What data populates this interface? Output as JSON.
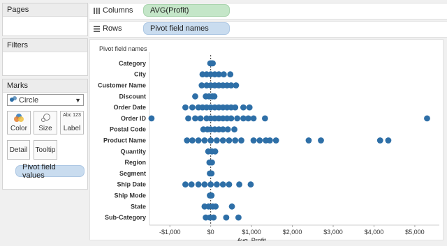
{
  "left_panels": {
    "pages": "Pages",
    "filters": "Filters",
    "marks": {
      "title": "Marks",
      "mark_type": "Circle",
      "buttons": [
        {
          "label": "Color",
          "icon": "color-icon"
        },
        {
          "label": "Size",
          "icon": "size-icon"
        },
        {
          "label": "Label",
          "icon": "label-icon",
          "icon_text": "Abc 123"
        },
        {
          "label": "Detail",
          "icon": "detail-icon"
        },
        {
          "label": "Tooltip",
          "icon": "tooltip-icon"
        }
      ],
      "field_pill": "Pivot field values"
    }
  },
  "shelves": {
    "columns": {
      "label": "Columns",
      "pill": "AVG(Profit)"
    },
    "rows": {
      "label": "Rows",
      "pill": "Pivot field names"
    }
  },
  "colors": {
    "mark": "#2e6fa7",
    "axis": "#cfcfcf",
    "zero_line": "#333333"
  },
  "chart_data": {
    "type": "scatter",
    "header": "Pivot field names",
    "xlabel": "Avg. Profit",
    "xlim": [
      -1500,
      5600
    ],
    "xticks": [
      "-$1,000",
      "$0",
      "$1,000",
      "$2,000",
      "$3,000",
      "$4,000",
      "$5,000"
    ],
    "xtick_values": [
      -1000,
      0,
      1000,
      2000,
      3000,
      4000,
      5000
    ],
    "categories": [
      "Category",
      "City",
      "Customer Name",
      "Discount",
      "Order Date",
      "Order ID",
      "Postal Code",
      "Product Name",
      "Quantity",
      "Region",
      "Segment",
      "Ship Date",
      "Ship Mode",
      "State",
      "Sub-Category"
    ],
    "series": [
      {
        "category": "Category",
        "x": [
          -10,
          20,
          50
        ]
      },
      {
        "category": "City",
        "x": [
          -200,
          -100,
          0,
          100,
          200,
          320,
          480
        ]
      },
      {
        "category": "Customer Name",
        "x": [
          -220,
          -100,
          0,
          100,
          200,
          300,
          400,
          500,
          620
        ]
      },
      {
        "category": "Discount",
        "x": [
          -380,
          -120,
          -40,
          40,
          90
        ]
      },
      {
        "category": "Order Date",
        "x": [
          -620,
          -450,
          -300,
          -200,
          -100,
          0,
          100,
          200,
          300,
          400,
          500,
          600,
          800,
          950
        ]
      },
      {
        "category": "Order ID",
        "x": [
          -1450,
          -550,
          -380,
          -250,
          -100,
          0,
          100,
          200,
          300,
          400,
          500,
          650,
          800,
          920,
          1050,
          1330,
          5300
        ]
      },
      {
        "category": "Postal Code",
        "x": [
          -180,
          -80,
          0,
          100,
          200,
          300,
          420,
          580
        ]
      },
      {
        "category": "Product Name",
        "x": [
          -580,
          -450,
          -300,
          -150,
          0,
          150,
          300,
          450,
          600,
          750,
          1050,
          1200,
          1350,
          1450,
          1600,
          2400,
          2700,
          4150,
          4350
        ]
      },
      {
        "category": "Quantity",
        "x": [
          -60,
          30,
          110
        ]
      },
      {
        "category": "Region",
        "x": [
          -30,
          30
        ]
      },
      {
        "category": "Segment",
        "x": [
          -20,
          20
        ]
      },
      {
        "category": "Ship Date",
        "x": [
          -620,
          -470,
          -300,
          -150,
          0,
          150,
          300,
          450,
          700,
          980
        ]
      },
      {
        "category": "Ship Mode",
        "x": [
          -20,
          20
        ]
      },
      {
        "category": "State",
        "x": [
          -150,
          -50,
          50,
          120,
          520
        ]
      },
      {
        "category": "Sub-Category",
        "x": [
          -120,
          -20,
          70,
          380,
          680
        ]
      }
    ]
  }
}
